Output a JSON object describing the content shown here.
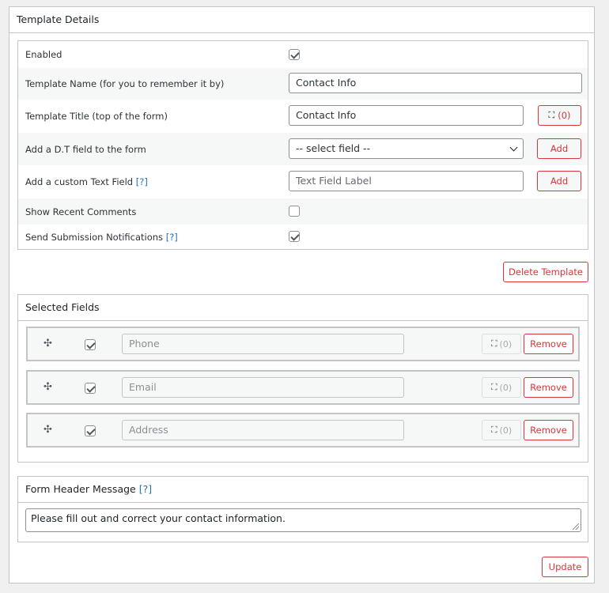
{
  "template_details": {
    "title": "Template Details",
    "rows": [
      {
        "label": "Enabled",
        "checked": true
      },
      {
        "label": "Template Name (for you to remember it by)",
        "value": "Contact Info"
      },
      {
        "label": "Template Title (top of the form)",
        "value": "Contact Info",
        "translate_count": "(0)"
      },
      {
        "label": "Add a D.T field to the form",
        "select_value": "-- select field --",
        "add_label": "Add"
      },
      {
        "label": "Add a custom Text Field",
        "help": "[?]",
        "placeholder": "Text Field Label",
        "add_label": "Add"
      },
      {
        "label": "Show Recent Comments",
        "checked": false
      },
      {
        "label": "Send Submission Notifications",
        "help": "[?]",
        "checked": true
      }
    ],
    "delete_label": "Delete Template"
  },
  "selected_fields": {
    "title": "Selected Fields",
    "icons": {
      "drag": "move-icon",
      "translate": "translate-icon"
    },
    "items": [
      {
        "placeholder": "Phone",
        "checked": true,
        "translate_count": "(0)",
        "remove_label": "Remove"
      },
      {
        "placeholder": "Email",
        "checked": true,
        "translate_count": "(0)",
        "remove_label": "Remove"
      },
      {
        "placeholder": "Address",
        "checked": true,
        "translate_count": "(0)",
        "remove_label": "Remove"
      }
    ]
  },
  "form_header": {
    "title": "Form Header Message",
    "help": "[?]",
    "value": "Please fill out and correct your contact information."
  },
  "update_label": "Update",
  "colors": {
    "accent_red": "#d63638",
    "help_blue": "#2271b1",
    "border": "#c3c4c7"
  }
}
